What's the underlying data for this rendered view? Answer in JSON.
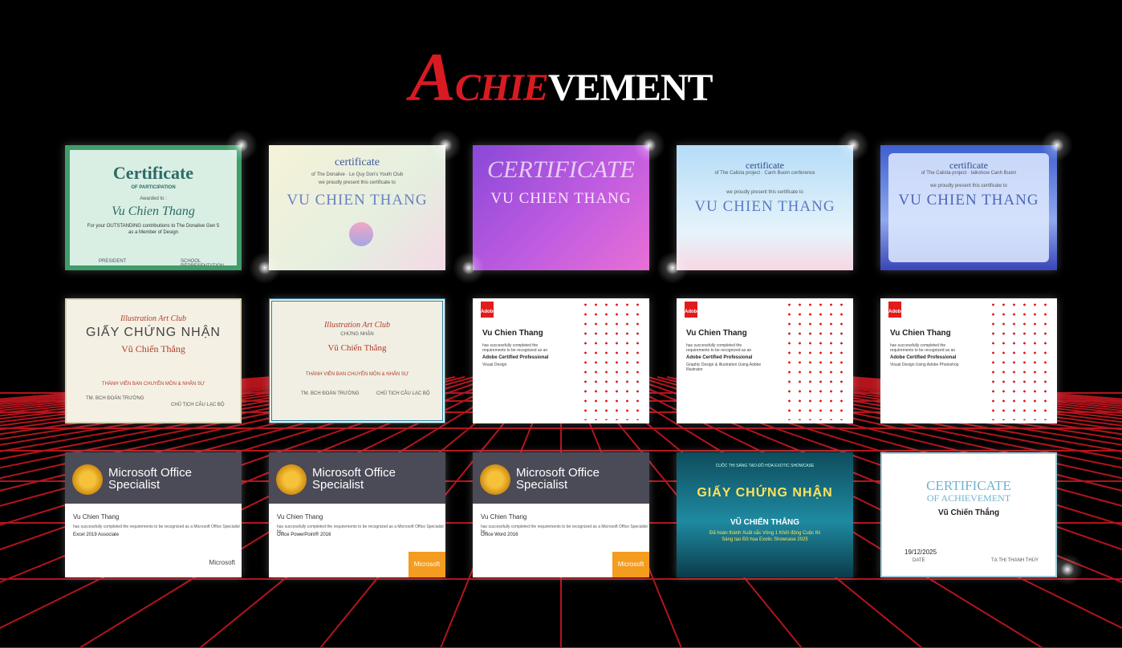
{
  "page_title": {
    "first_letter": "A",
    "mid": "CHIE",
    "rest": "VEMENT"
  },
  "certificates": [
    {
      "heading": "Certificate",
      "sub": "OF PARTICIPATION",
      "awarded": "Awarded to :",
      "recipient": "Vu Chien Thang",
      "line1": "For your OUTSTANDING contributions to The Donalive Gen 5",
      "line2": "as a Member of Design",
      "sig_left": "PRESIDENT",
      "sig_right": "SCHOOL REPRESENTATION"
    },
    {
      "heading": "certificate",
      "org": "of The Donalive · Le Quy Don's Youth Club",
      "intro": "we proudly present this certificate to",
      "recipient": "VU CHIEN THANG"
    },
    {
      "heading": "CERTIFICATE",
      "recipient": "VU CHIEN THANG"
    },
    {
      "heading": "certificate",
      "org": "of The Calista project · Canh Buom conference",
      "intro": "we proudly present this certificate to",
      "recipient": "VU CHIEN THANG"
    },
    {
      "heading": "certificate",
      "org": "of The Calista project · talkshow Canh Buom",
      "intro": "we proudly present this certificate to",
      "recipient": "VU CHIEN THANG"
    },
    {
      "club": "Illustration Art Club",
      "heading": "GIẤY CHỨNG NHẬN",
      "recipient": "Vũ Chiến Thắng",
      "role": "THÀNH VIÊN BAN CHUYÊN MÔN & NHÂN SỰ",
      "sig_left": "TM. BCH ĐOÀN TRƯỜNG",
      "sig_right": "CHỦ TỊCH CÂU LẠC BỘ"
    },
    {
      "club": "Illustration Art Club",
      "heading": "CHỨNG NHẬN",
      "recipient": "Vũ Chiến Thắng",
      "role": "THÀNH VIÊN BAN CHUYÊN MÔN & NHÂN SỰ",
      "sig_left": "TM. BCH ĐOÀN TRƯỜNG",
      "sig_right": "CHỦ TỊCH CÂU LẠC BỘ"
    },
    {
      "logo": "Adobe",
      "recipient": "Vu Chien Thang",
      "l1": "has successfully completed the",
      "l2": "requirements to be recognized as an",
      "title": "Adobe Certified Professional",
      "track": "Visual Design"
    },
    {
      "logo": "Adobe",
      "recipient": "Vu Chien Thang",
      "l1": "has successfully completed the",
      "l2": "requirements to be recognized as an",
      "title": "Adobe Certified Professional",
      "track": "Graphic Design & Illustration Using Adobe Illustrator"
    },
    {
      "logo": "Adobe",
      "recipient": "Vu Chien Thang",
      "l1": "has successfully completed the",
      "l2": "requirements to be recognized as an",
      "title": "Adobe Certified Professional",
      "track": "Visual Design Using Adobe Photoshop"
    },
    {
      "head1": "Microsoft Office",
      "head2": "Specialist",
      "recipient": "Vu Chien Thang",
      "l1": "has successfully completed the requirements to be recognized as a Microsoft Office Specialist",
      "track": "Excel 2019 Associate",
      "brand": "Microsoft"
    },
    {
      "head1": "Microsoft Office",
      "head2": "Specialist",
      "recipient": "Vu Chien Thang",
      "l1": "has successfully completed the requirements to be recognized as a Microsoft Office Specialist for",
      "track": "Office PowerPoint® 2016",
      "brand": "Microsoft"
    },
    {
      "head1": "Microsoft Office",
      "head2": "Specialist",
      "recipient": "Vu Chien Thang",
      "l1": "has successfully completed the requirements to be recognized as a Microsoft Office Specialist for",
      "track": "Office Word 2016",
      "brand": "Microsoft"
    },
    {
      "top": "CUỘC THI SÁNG TẠO ĐỒ HỌA EXOTIC SHOWCASE",
      "heading": "GIẤY CHỨNG NHẬN",
      "recipient": "VŨ CHIẾN THẮNG",
      "l1": "Đã hoàn thành Xuất sắc Vòng 1 Khởi động Cuộc thi",
      "l2": "Sáng tạo Đồ họa Exotic Showcase 2025"
    },
    {
      "heading1": "CERTIFICATE",
      "heading2": "OF ACHIEVEMENT",
      "recipient": "Vũ Chiến Thắng",
      "date": "19/12/2025",
      "date_label": "DATE",
      "signer": "TẠ THỊ THANH THÚY"
    }
  ],
  "colors": {
    "background": "#000000",
    "grid": "#b3141c",
    "title_accent": "#d91a22"
  }
}
